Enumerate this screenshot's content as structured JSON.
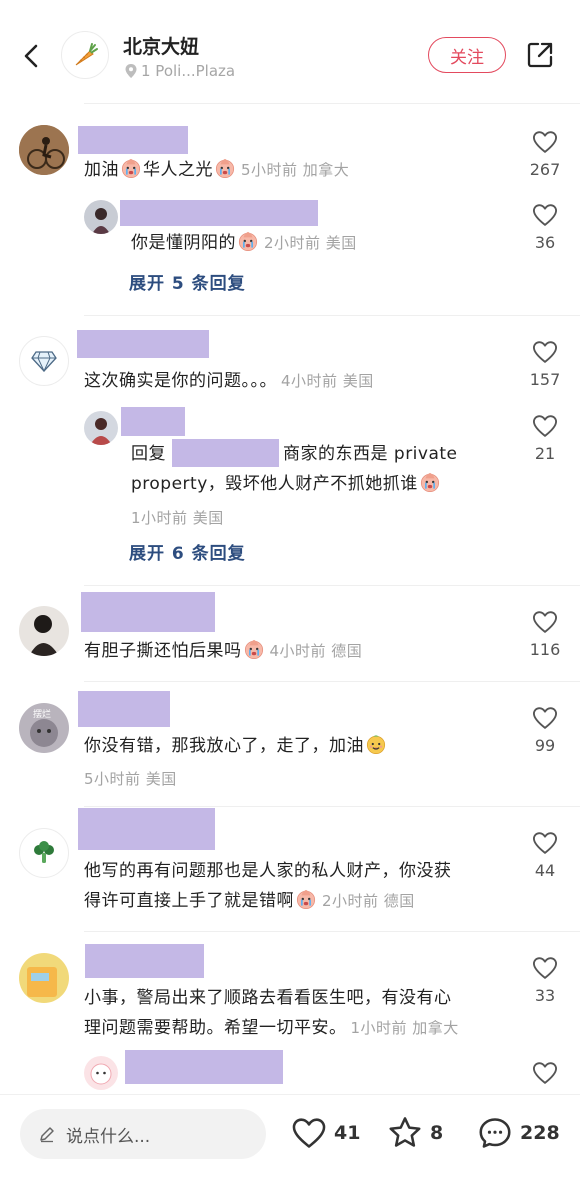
{
  "header": {
    "author_name": "北京大妞",
    "location": "1 Poli...Plaza",
    "follow_label": "关注"
  },
  "comments": [
    {
      "text_parts": [
        "加油",
        "华人之光"
      ],
      "meta": "5小时前 加拿大",
      "likes": "267",
      "reply": {
        "text": "你是懂阴阳的",
        "meta": "2小时前 美国",
        "likes": "36"
      },
      "expand": "展开 5 条回复"
    },
    {
      "text": "这次确实是你的问题。。。",
      "meta": "4小时前 美国",
      "likes": "157",
      "reply": {
        "prefix": "回复",
        "text_rest": "商家的东西是 private",
        "text_line2": "property，毁坏他人财产不抓她抓谁",
        "meta": "1小时前 美国",
        "likes": "21"
      },
      "expand": "展开 6 条回复"
    },
    {
      "text": "有胆子撕还怕后果吗",
      "meta": "4小时前 德国",
      "likes": "116"
    },
    {
      "text": "你没有错，那我放心了，走了，加油",
      "meta": "5小时前 美国",
      "likes": "99",
      "avatar_label": "摆烂"
    },
    {
      "text_line1": "他写的再有问题那也是人家的私人财产，你没获",
      "text_line2": "得许可直接上手了就是错啊",
      "meta": "2小时前 德国",
      "likes": "44"
    },
    {
      "text_line1": "小事，警局出来了顺路去看看医生吧，有没有心",
      "text_line2": "理问题需要帮助。希望一切平安。",
      "meta": "1小时前 加拿大",
      "likes": "33"
    }
  ],
  "bottom_bar": {
    "input_placeholder": "说点什么...",
    "likes": "41",
    "favorites": "8",
    "comments": "228"
  },
  "colors": {
    "accent": "#e34a5e",
    "link": "#2d4d7f",
    "redaction": "#c4b8e6"
  },
  "icons": [
    "back-icon",
    "carrot-icon",
    "location-pin-icon",
    "share-icon",
    "heart-icon",
    "diamond-icon",
    "broccoli-icon",
    "pencil-icon",
    "star-icon",
    "comment-bubble-icon",
    "crying-emoji-icon",
    "smile-emoji-icon"
  ]
}
